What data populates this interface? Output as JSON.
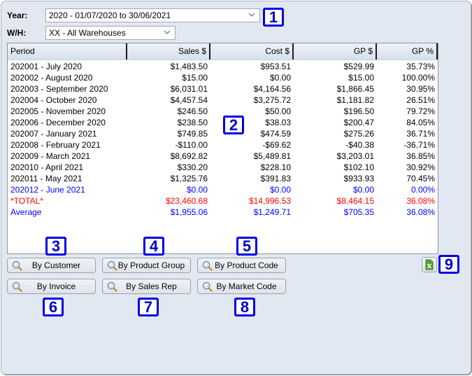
{
  "filters": {
    "year_label": "Year:",
    "year_value": "2020 - 01/07/2020 to 30/06/2021",
    "wh_label": "W/H:",
    "wh_value": "XX - All Warehouses"
  },
  "table": {
    "columns": [
      "Period",
      "Sales $",
      "Cost $",
      "GP $",
      "GP %"
    ],
    "rows": [
      {
        "period": "202001 - July 2020",
        "sales": "$1,483.50",
        "cost": "$953.51",
        "gp": "$529.99",
        "gpp": "35.73%",
        "style": "normal"
      },
      {
        "period": "202002 - August 2020",
        "sales": "$15.00",
        "cost": "$0.00",
        "gp": "$15.00",
        "gpp": "100.00%",
        "style": "normal"
      },
      {
        "period": "202003 - September 2020",
        "sales": "$6,031.01",
        "cost": "$4,164.56",
        "gp": "$1,866.45",
        "gpp": "30.95%",
        "style": "normal"
      },
      {
        "period": "202004 - October 2020",
        "sales": "$4,457.54",
        "cost": "$3,275.72",
        "gp": "$1,181.82",
        "gpp": "26.51%",
        "style": "normal"
      },
      {
        "period": "202005 - November 2020",
        "sales": "$246.50",
        "cost": "$50.00",
        "gp": "$196.50",
        "gpp": "79.72%",
        "style": "normal"
      },
      {
        "period": "202006 - December 2020",
        "sales": "$238.50",
        "cost": "$38.03",
        "gp": "$200.47",
        "gpp": "84.05%",
        "style": "normal"
      },
      {
        "period": "202007 - January 2021",
        "sales": "$749.85",
        "cost": "$474.59",
        "gp": "$275.26",
        "gpp": "36.71%",
        "style": "normal"
      },
      {
        "period": "202008 - February 2021",
        "sales": "-$110.00",
        "cost": "-$69.62",
        "gp": "-$40.38",
        "gpp": "-36.71%",
        "style": "normal"
      },
      {
        "period": "202009 - March 2021",
        "sales": "$8,692.82",
        "cost": "$5,489.81",
        "gp": "$3,203.01",
        "gpp": "36.85%",
        "style": "normal"
      },
      {
        "period": "202010 - April 2021",
        "sales": "$330.20",
        "cost": "$228.10",
        "gp": "$102.10",
        "gpp": "30.92%",
        "style": "normal"
      },
      {
        "period": "202011 - May 2021",
        "sales": "$1,325.76",
        "cost": "$391.83",
        "gp": "$933.93",
        "gpp": "70.45%",
        "style": "normal"
      },
      {
        "period": "202012 - June 2021",
        "sales": "$0.00",
        "cost": "$0.00",
        "gp": "$0.00",
        "gpp": "0.00%",
        "style": "current"
      },
      {
        "period": "*TOTAL*",
        "sales": "$23,460.68",
        "cost": "$14,996.53",
        "gp": "$8,464.15",
        "gpp": "36.08%",
        "style": "total"
      },
      {
        "period": "Average",
        "sales": "$1,955.06",
        "cost": "$1,249.71",
        "gp": "$705.35",
        "gpp": "36.08%",
        "style": "average"
      }
    ]
  },
  "buttons": {
    "by_customer": "By Customer",
    "by_product_group": "By Product Group",
    "by_product_code": "By Product Code",
    "by_invoice": "By Invoice",
    "by_sales_rep": "By Sales Rep",
    "by_market_code": "By Market Code",
    "export_icon": "excel-export-icon"
  },
  "callouts": [
    "1",
    "2",
    "3",
    "4",
    "5",
    "6",
    "7",
    "8",
    "9"
  ],
  "colors": {
    "normal": "#000000",
    "current": "#0000ff",
    "total": "#ff0000",
    "average": "#0000ff",
    "callout_border": "#0000e6"
  }
}
